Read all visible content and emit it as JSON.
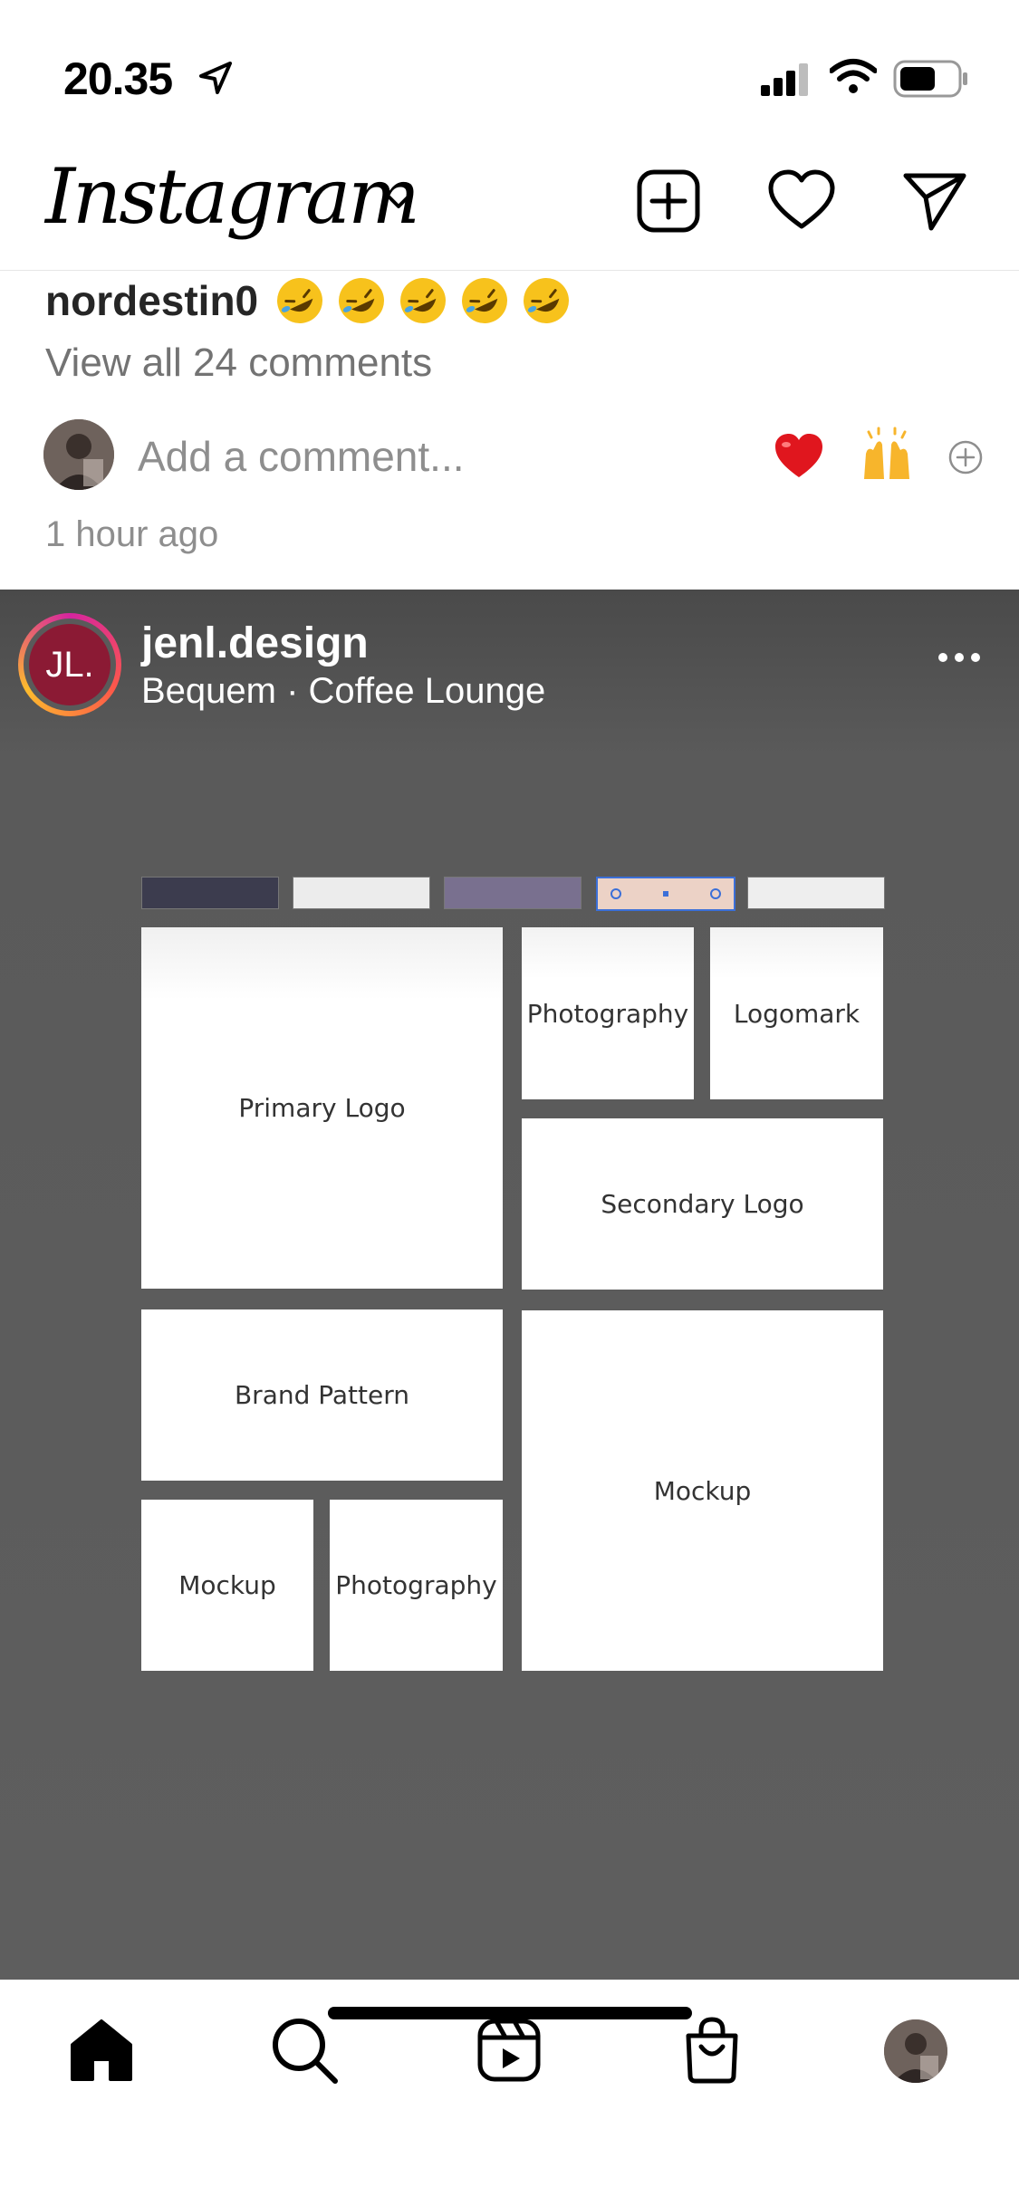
{
  "status_bar": {
    "time": "20.35",
    "icons": [
      "location-arrow-icon",
      "cellular-signal-icon",
      "wifi-icon",
      "battery-icon"
    ]
  },
  "header": {
    "brand": "Instagram",
    "icons": [
      "chevron-down-icon",
      "new-post-icon",
      "heart-icon",
      "direct-message-icon"
    ]
  },
  "previous_post": {
    "caption_user": "nordestin0",
    "caption_emoji_count": 5,
    "view_comments": "View all 24 comments",
    "comment_placeholder": "Add a comment...",
    "quick_reactions": [
      "red-heart-emoji",
      "raising-hands-emoji"
    ],
    "time_ago": "1 hour ago"
  },
  "post": {
    "avatar_initials": "JL.",
    "username": "jenl.design",
    "location": "Bequem · Coffee Lounge",
    "moodboard": {
      "swatch_colors": [
        "#3c3c4e",
        "#ececec",
        "#79708f",
        "#ecd2c6",
        "#eeeeee"
      ],
      "tiles": {
        "primary_logo": "Primary Logo",
        "photography_top": "Photography",
        "logomark": "Logomark",
        "secondary_logo": "Secondary Logo",
        "brand_pattern": "Brand Pattern",
        "mockup_large": "Mockup",
        "mockup_small": "Mockup",
        "photography_bottom": "Photography"
      }
    }
  },
  "bottom_nav": {
    "tabs": [
      "home-icon",
      "search-icon",
      "reels-icon",
      "shop-icon",
      "profile-avatar"
    ],
    "active": "home"
  },
  "colors": {
    "text": "#262626",
    "muted": "#8e8e8e",
    "avatar_bg": "#8b1a34",
    "post_bg": "#5e5e5e"
  }
}
